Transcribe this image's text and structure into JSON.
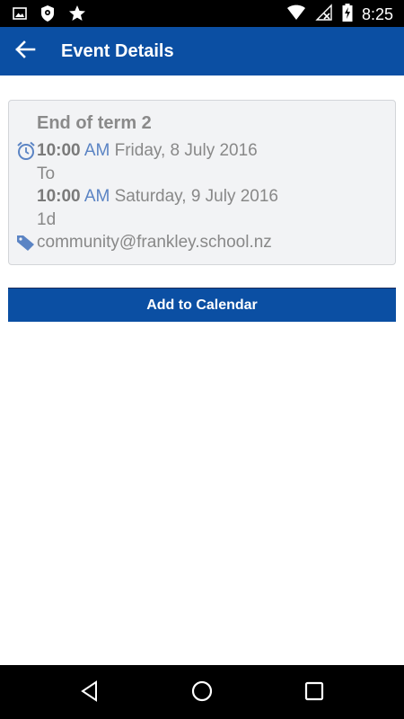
{
  "status_bar": {
    "time": "8:25",
    "icons": [
      "image-icon",
      "shield-icon",
      "star-icon",
      "wifi-icon",
      "no-signal-icon",
      "battery-charging-icon"
    ]
  },
  "app_bar": {
    "title": "Event Details",
    "back_icon": "arrow-back-icon"
  },
  "event": {
    "title": "End of term 2",
    "start_time": "10:00",
    "start_ampm": "AM",
    "start_date": "Friday, 8 July 2016",
    "to_label": "To",
    "end_time": "10:00",
    "end_ampm": "AM",
    "end_date": "Saturday, 9 July 2016",
    "duration": "1d",
    "email": "community@frankley.school.nz",
    "clock_icon": "alarm-clock-icon",
    "tag_icon": "tag-icon"
  },
  "actions": {
    "add_to_calendar": "Add to Calendar"
  },
  "nav_bar": {
    "icons": [
      "back-triangle-icon",
      "home-circle-icon",
      "recents-square-icon"
    ]
  },
  "colors": {
    "app_bar": "#0b4fa3",
    "link_blue": "#5b84c4",
    "card_bg": "#f2f3f5"
  }
}
